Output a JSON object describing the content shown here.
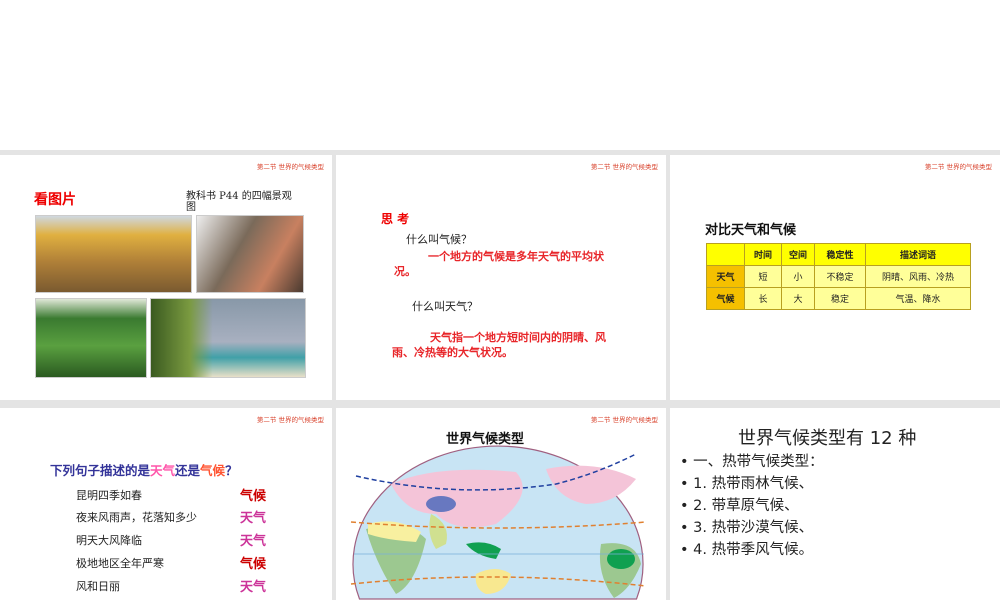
{
  "header": "第二节 世界的气候类型",
  "slide1": {
    "title": "看图片",
    "caption": "教科书 P44 的四幅景观图"
  },
  "slide2": {
    "heading": "思 考",
    "q1": "什么叫气候？",
    "a1": "一个地方的气候是多年天气的平均状况。",
    "q2": "什么叫天气？",
    "a2": "天气指一个地方短时间内的阴晴、风雨、冷热等的大气状况。"
  },
  "slide3": {
    "title": "对比天气和气候",
    "columns": [
      "",
      "时间",
      "空间",
      "稳定性",
      "描述词语"
    ],
    "rows": [
      [
        "天气",
        "短",
        "小",
        "不稳定",
        "阴晴、风雨、冷热"
      ],
      [
        "气候",
        "长",
        "大",
        "稳定",
        "气温、降水"
      ]
    ]
  },
  "slide4": {
    "title_prefix": "下列句子描述的是",
    "title_weather": "天气",
    "title_mid": "还是",
    "title_climate": "气候",
    "title_suffix": "？",
    "items": [
      {
        "q": "昆明四季如春",
        "a": "气候"
      },
      {
        "q": "夜来风雨声，花落知多少",
        "a": "天气"
      },
      {
        "q": "明天大风降临",
        "a": "天气"
      },
      {
        "q": "极地地区全年严寒",
        "a": "气候"
      },
      {
        "q": "风和日丽",
        "a": "天气"
      }
    ]
  },
  "slide5": {
    "title": "世界气候类型"
  },
  "slide6": {
    "title": "世界气候类型有 12 种",
    "bullets": [
      "一、热带气候类型：",
      "1. 热带雨林气候、",
      "2. 带草原气候、",
      "3. 热带沙漠气候、",
      "4. 热带季风气候。"
    ]
  },
  "colors": {
    "header": "#d8402a",
    "weather": "#cc3399",
    "climate": "#cc0000",
    "answer_red": "#e8262a",
    "question": "#333399"
  }
}
